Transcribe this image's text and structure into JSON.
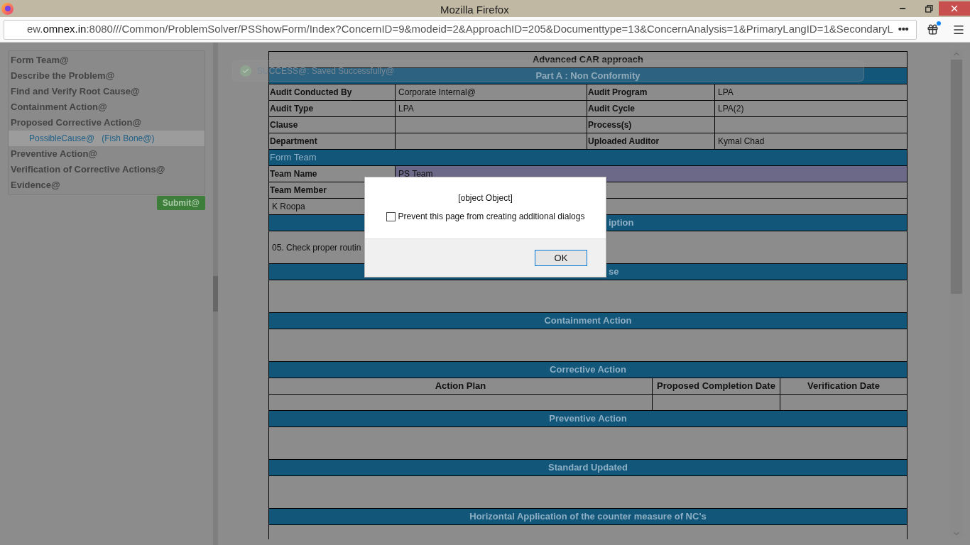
{
  "window": {
    "title": "Mozilla Firefox"
  },
  "toolbar": {
    "url_host_prefix": "ew.",
    "url_host": "omnex.in",
    "url_rest": ":8080///Common/ProblemSolver/PSShowForm/Index?ConcernID=9&modeid=2&ApproachID=205&Documenttype=13&ConcernAnalysis=1&PrimaryLangID=1&SecondaryL",
    "more": "•••"
  },
  "sidebar": {
    "items": [
      {
        "label": "Form Team@",
        "selected": false
      },
      {
        "label": "Describe the Problem@",
        "selected": false
      },
      {
        "label": "Find and Verify Root Cause@",
        "selected": false
      },
      {
        "label": "Containment Action@",
        "selected": false
      },
      {
        "label": "Proposed Corrective Action@",
        "selected": false,
        "children": [
          {
            "label": "PossibleCause@",
            "extra": "(Fish Bone@)",
            "selected": true
          }
        ]
      },
      {
        "label": "Preventive Action@",
        "selected": false
      },
      {
        "label": "Verification of Corrective Actions@",
        "selected": false
      },
      {
        "label": "Evidence@",
        "selected": false
      }
    ],
    "submit": "Submit@"
  },
  "toast": {
    "text": "SUCCESS@: Saved Successfully@"
  },
  "form": [
    {
      "kind": "title",
      "text": "Advanced CAR approach"
    },
    {
      "kind": "band",
      "text": "Part A : Non Conformity"
    },
    {
      "kind": "pair",
      "label": "Audit Conducted By",
      "value": "Corporate Internal@",
      "label_2": "Audit Program",
      "value_2": "LPA"
    },
    {
      "kind": "pair",
      "label": "Audit Type",
      "value": "LPA",
      "label_2": "Audit Cycle",
      "value_2": "LPA(2)"
    },
    {
      "kind": "pair",
      "label": "Clause",
      "label_2": "Process(s)"
    },
    {
      "kind": "pair",
      "label": "Department",
      "label_2": "Uploaded Auditor",
      "value_2": "Kymal Chad"
    },
    {
      "kind": "band-left",
      "text": "Form Team"
    },
    {
      "kind": "field",
      "label": "Team Name",
      "value": "PS Team",
      "highlighted": true
    },
    {
      "kind": "field",
      "label": "Team Member",
      "highlighted": false
    },
    {
      "kind": "line",
      "text": "K Roopa"
    },
    {
      "kind": "band-cut",
      "text": "iption"
    },
    {
      "kind": "body",
      "text": "05. Check proper routin"
    },
    {
      "kind": "band-cut",
      "text": "se"
    },
    {
      "kind": "body"
    },
    {
      "kind": "band",
      "text": "Containment Action"
    },
    {
      "kind": "body"
    },
    {
      "kind": "band",
      "text": "Corrective Action"
    },
    {
      "kind": "columns",
      "columns": [
        "Action Plan",
        "Proposed Completion Date",
        "Verification Date"
      ]
    },
    {
      "kind": "empty-row"
    },
    {
      "kind": "band",
      "text": "Preventive Action"
    },
    {
      "kind": "body"
    },
    {
      "kind": "band",
      "text": "Standard Updated"
    },
    {
      "kind": "body"
    },
    {
      "kind": "band",
      "text": "Horizontal Application of the counter measure of NC's"
    },
    {
      "kind": "tail"
    }
  ],
  "dialog": {
    "message": "[object Object]",
    "checkbox": {
      "label": "Prevent this page from creating additional dialogs",
      "checked": false
    },
    "ok": "OK"
  }
}
